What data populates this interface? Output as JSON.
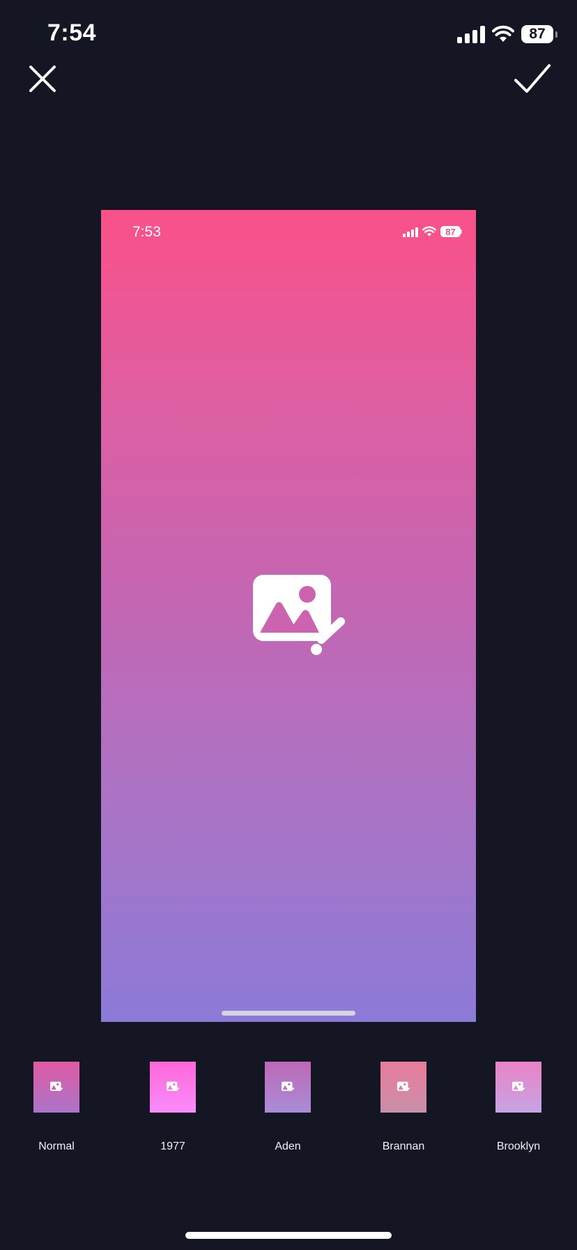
{
  "status_bar": {
    "time": "7:54",
    "battery": "87"
  },
  "toolbar": {
    "close_icon": "close-icon",
    "confirm_icon": "checkmark-icon"
  },
  "preview": {
    "status_time": "7:53",
    "battery": "87",
    "center_icon": "image-edit-icon",
    "gradient_colors": [
      "#fa5189",
      "#c466b3",
      "#8c7ad8"
    ]
  },
  "filters": [
    {
      "label": "Normal",
      "colors": [
        "#df5aa3",
        "#ab74c8"
      ]
    },
    {
      "label": "1977",
      "colors": [
        "#ff67d9",
        "#f98cfc"
      ]
    },
    {
      "label": "Aden",
      "colors": [
        "#bd69b6",
        "#a98cd6"
      ]
    },
    {
      "label": "Brannan",
      "colors": [
        "#e87c9c",
        "#c98fa9"
      ]
    },
    {
      "label": "Brooklyn",
      "colors": [
        "#ea82c6",
        "#c5a4e3"
      ]
    }
  ],
  "colors": {
    "background": "#141624",
    "foreground": "#ffffff"
  }
}
